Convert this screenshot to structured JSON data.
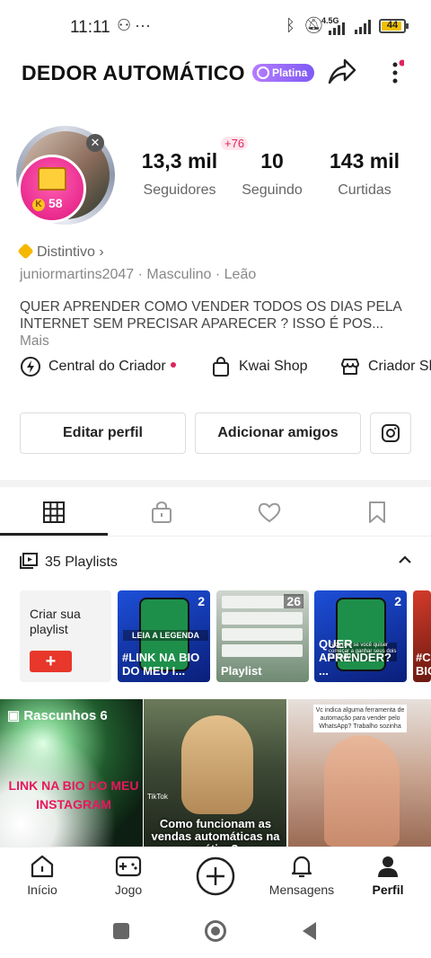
{
  "status_bar": {
    "time": "11:11",
    "network": "4.5G",
    "battery": "44"
  },
  "header": {
    "title": "DEDOR AUTOMÁTICO",
    "badge": "Platina"
  },
  "avatar": {
    "coins": "58",
    "notification_badge": "+76"
  },
  "stats": [
    {
      "value": "13,3 mil",
      "label": "Seguidores"
    },
    {
      "value": "10",
      "label": "Seguindo"
    },
    {
      "value": "143 mil",
      "label": "Curtidas"
    }
  ],
  "profile": {
    "distintivo": "Distintivo",
    "username": "juniormartins2047",
    "gender": "Masculino",
    "sign": "Leão",
    "bio": "QUER APRENDER COMO VENDER TODOS OS DIAS PELA INTERNET SEM PRECISAR APARECER ? ISSO É POS...",
    "bio_more": "Mais"
  },
  "shortcuts": [
    {
      "label": "Central do Criador",
      "icon": "lightning-icon"
    },
    {
      "label": "Kwai Shop",
      "icon": "shopping-bag-icon"
    },
    {
      "label": "Criador Sh",
      "icon": "store-icon"
    }
  ],
  "buttons": {
    "edit_profile": "Editar perfil",
    "add_friends": "Adicionar amigos"
  },
  "tabs": [
    "grid-icon",
    "lock-icon",
    "heart-icon",
    "bookmark-icon"
  ],
  "playlists": {
    "header": "35 Playlists",
    "create_label": "Criar sua playlist",
    "items": [
      {
        "count": "2",
        "label": "#LINK NA BIO DO MEU I...",
        "overlay": "LEIA A LEGENDA"
      },
      {
        "count": "26",
        "label": "Playlist"
      },
      {
        "count": "2",
        "label": "QUER APRENDER? ...",
        "overlay": "Faça isso se você quiser começar a ganhar seus dois na Kiwify!"
      },
      {
        "count": "",
        "label": "#C BIO"
      }
    ]
  },
  "grid": [
    {
      "caption": "LINK NA BIO DO MEU INSTAGRAM",
      "overlay": "Rascunhos 6"
    },
    {
      "caption": "Como funcionam as vendas automáticas na prática?",
      "overlay": "TikTok"
    },
    {
      "caption": "Vc indica alguma ferramenta de automação para vender pelo WhatsApp? Trabalho sozinha",
      "overlay": ""
    }
  ],
  "bottom_nav": [
    {
      "label": "Início",
      "icon": "home-icon"
    },
    {
      "label": "Jogo",
      "icon": "gamepad-icon"
    },
    {
      "label": "",
      "icon": "plus-circle-icon"
    },
    {
      "label": "Mensagens",
      "icon": "bell-icon"
    },
    {
      "label": "Perfil",
      "icon": "person-icon"
    }
  ]
}
